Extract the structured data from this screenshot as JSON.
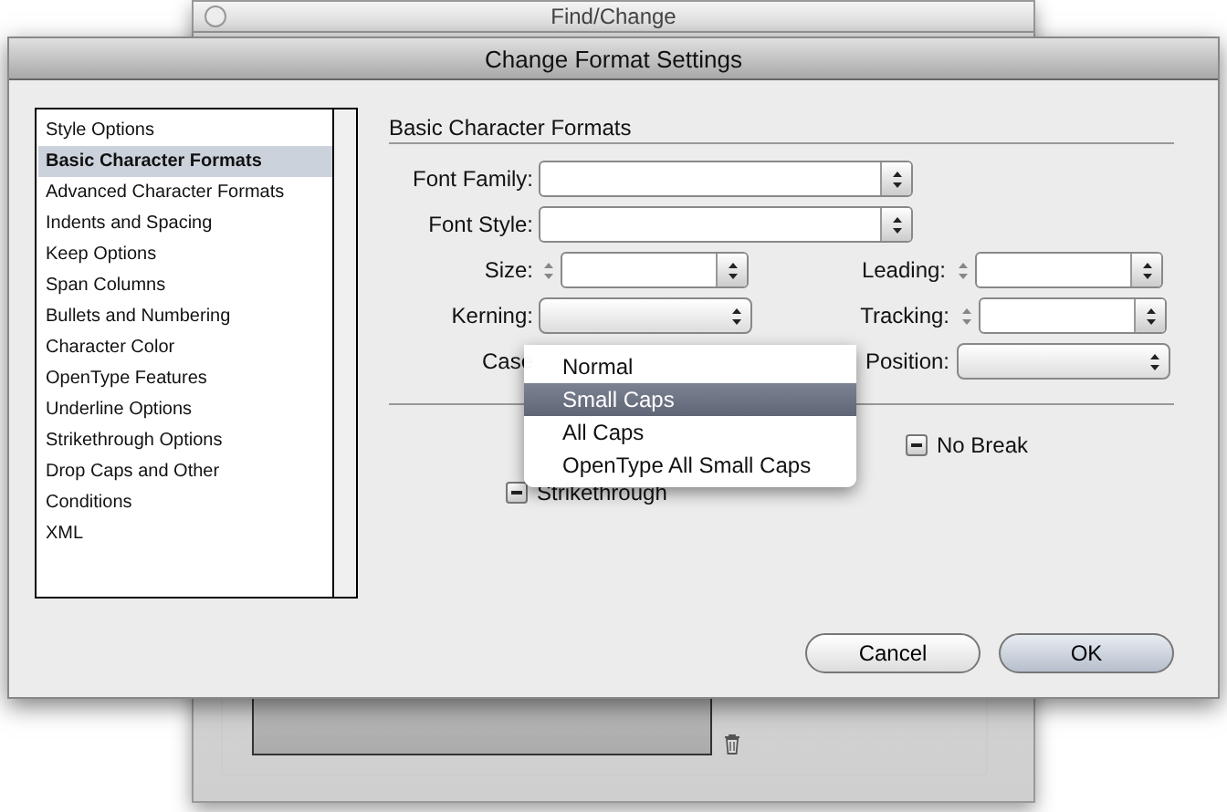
{
  "background_window": {
    "title": "Find/Change"
  },
  "dialog": {
    "title": "Change Format Settings"
  },
  "sidebar": {
    "items": [
      {
        "label": "Style Options",
        "selected": false
      },
      {
        "label": "Basic Character Formats",
        "selected": true
      },
      {
        "label": "Advanced Character Formats",
        "selected": false
      },
      {
        "label": "Indents and Spacing",
        "selected": false
      },
      {
        "label": "Keep Options",
        "selected": false
      },
      {
        "label": "Span Columns",
        "selected": false
      },
      {
        "label": "Bullets and Numbering",
        "selected": false
      },
      {
        "label": "Character Color",
        "selected": false
      },
      {
        "label": "OpenType Features",
        "selected": false
      },
      {
        "label": "Underline Options",
        "selected": false
      },
      {
        "label": "Strikethrough Options",
        "selected": false
      },
      {
        "label": "Drop Caps and Other",
        "selected": false
      },
      {
        "label": "Conditions",
        "selected": false
      },
      {
        "label": "XML",
        "selected": false
      }
    ]
  },
  "section": {
    "title": "Basic Character Formats"
  },
  "rows": [
    {
      "fields": [
        {
          "kind": "combo",
          "label": "Font Family:"
        }
      ]
    },
    {
      "fields": [
        {
          "kind": "combo",
          "label": "Font Style:"
        }
      ]
    },
    {
      "fields": [
        {
          "kind": "stepper",
          "label": "Size:"
        },
        {
          "kind": "stepper",
          "label": "Leading:"
        }
      ]
    },
    {
      "fields": [
        {
          "kind": "popup",
          "label": "Kerning:"
        },
        {
          "kind": "stepper",
          "label": "Tracking:"
        }
      ]
    },
    {
      "fields": [
        {
          "kind": "hidden",
          "label": "Case"
        },
        {
          "kind": "popup",
          "label": "Position:"
        }
      ]
    }
  ],
  "case_menu": {
    "items": [
      {
        "label": "Normal",
        "selected": false
      },
      {
        "label": "Small Caps",
        "selected": true
      },
      {
        "label": "All Caps",
        "selected": false
      },
      {
        "label": "OpenType All Small Caps",
        "selected": false
      }
    ]
  },
  "options": [
    {
      "label": "No Break",
      "mixed": true
    },
    {
      "label": "Strikethrough",
      "mixed": true
    }
  ],
  "buttons": [
    {
      "label": "Cancel",
      "default": false
    },
    {
      "label": "OK",
      "default": true
    }
  ]
}
